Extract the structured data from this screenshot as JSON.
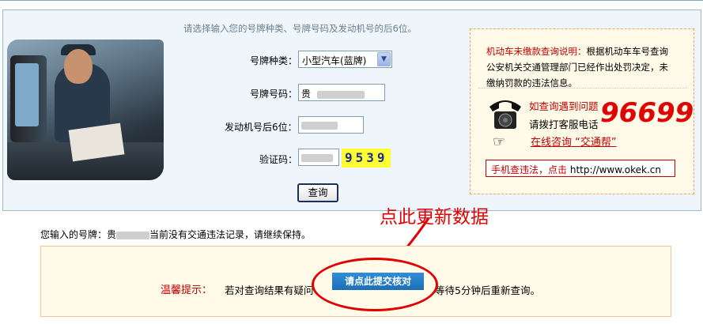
{
  "form": {
    "hint": "请选择输入您的号牌种类、号牌号码及发动机号的后6位。",
    "plate_type_label": "号牌种类：",
    "plate_type_value": "小型汽车(蓝牌)",
    "plate_no_label": "号牌号码：",
    "plate_no_value": "贵",
    "engine_label": "发动机号后6位：",
    "captcha_label": "验证码：",
    "captcha_value": "9539",
    "query_button": "查询"
  },
  "info": {
    "title": "机动车未缴款查询说明：",
    "desc": "根据机动车车号查询公安机关交通管理部门已经作出处罚决定，未缴纳罚款的违法信息。",
    "problem": "如查询遇到问题",
    "dial": "请拨打客服电话",
    "hotline": "96699",
    "online": "在线咨询 “交通帮”",
    "mobile_prefix": "手机查违法，点击",
    "mobile_url": "http://www.okek.cn"
  },
  "annotation": "点此更新数据",
  "result": {
    "prefix": "您输入的号牌：",
    "suffix": "当前没有交通违法记录，请继续保持。"
  },
  "tip": {
    "title": "温馨提示：",
    "text_before": "若对查询结果有疑问",
    "button": "请点此提交核对",
    "text_after": "等待5分钟后重新查询。"
  },
  "colors": {
    "accent_red": "#e00000",
    "panel_bg": "#eef6fb",
    "button_blue": "#1e6fb5"
  }
}
